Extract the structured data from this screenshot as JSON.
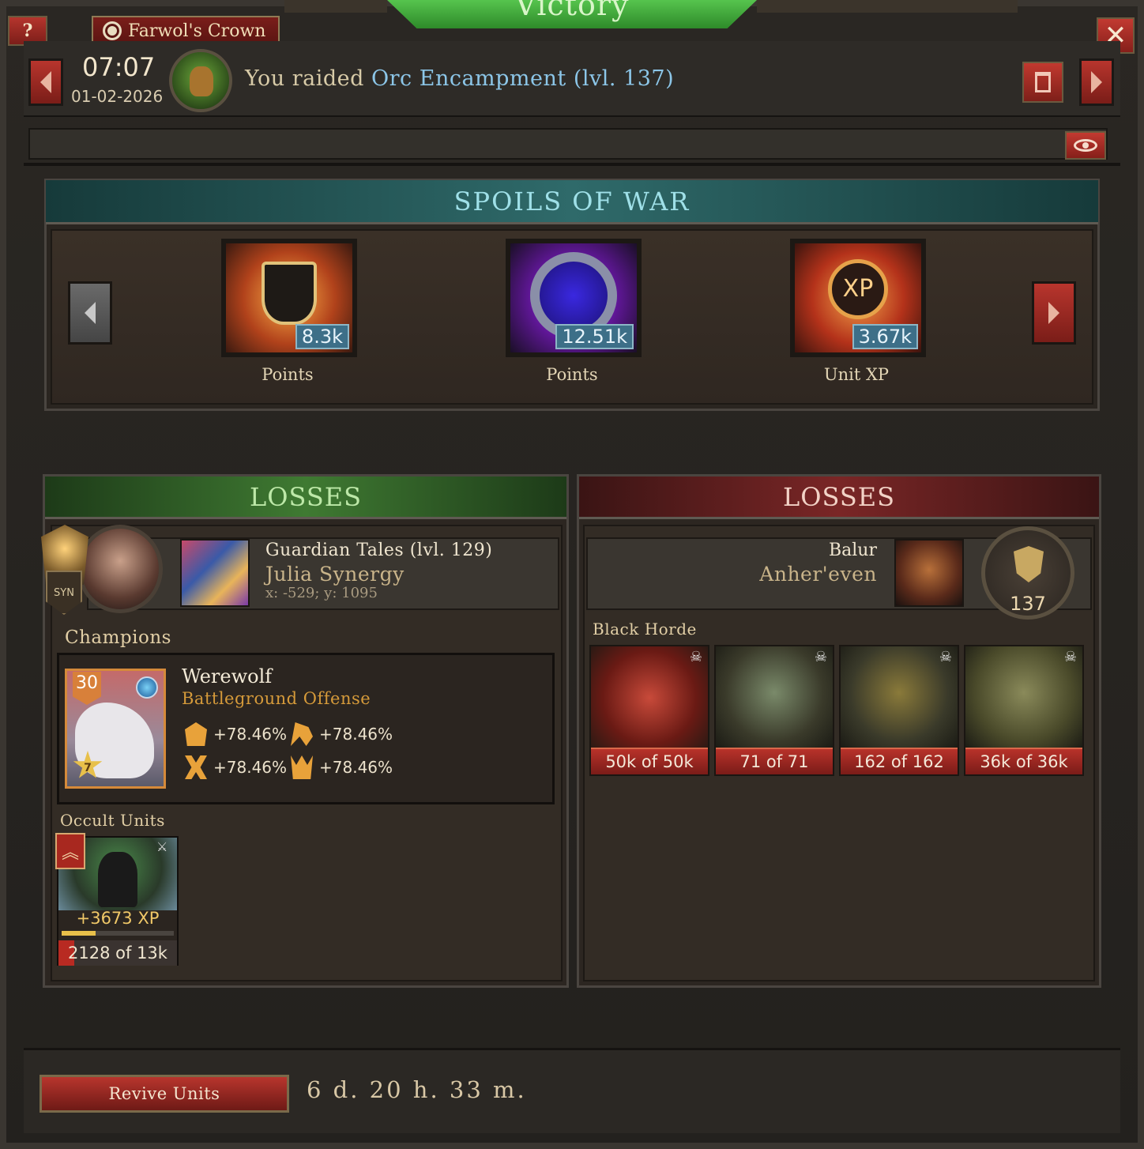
{
  "window": {
    "banner_title": "Victory",
    "realm": "Farwol's Crown",
    "help_label": "?",
    "close_label": "✕"
  },
  "report": {
    "time": "07:07",
    "date": "01-02-2026",
    "message_prefix": "You raided",
    "target": "Orc Encampment (lvl. 137)"
  },
  "spoils": {
    "title": "SPOILS OF WAR",
    "items": [
      {
        "amount": "8.3k",
        "label": "Points",
        "icon": "battle-banner-icon"
      },
      {
        "amount": "12.51k",
        "label": "Points",
        "icon": "arcane-gem-icon"
      },
      {
        "amount": "3.67k",
        "label": "Unit XP",
        "icon": "xp-icon"
      }
    ],
    "xp_glyph": "XP"
  },
  "attacker": {
    "losses_title": "LOSSES",
    "syn_label": "SYN",
    "guild": "Guardian Tales (lvl. 129)",
    "player": "Julia Synergy",
    "coords": "x: -529; y: 1095",
    "champions_label": "Champions",
    "champion": {
      "level": "30",
      "stars": "7",
      "name": "Werewolf",
      "role": "Battleground Offense",
      "bonuses": [
        "+78.46%",
        "+78.46%",
        "+78.46%",
        "+78.46%"
      ]
    },
    "units_label": "Occult Units",
    "unit": {
      "xp_gain": "+3673 XP",
      "xp_progress": 0.3,
      "count": "2128 of 13k"
    }
  },
  "defender": {
    "losses_title": "LOSSES",
    "name": "Balur",
    "sub": "Anher'even",
    "level": "137",
    "army_label": "Black Horde",
    "units": [
      {
        "loss": "50k of 50k"
      },
      {
        "loss": "71 of 71"
      },
      {
        "loss": "162 of 162"
      },
      {
        "loss": "36k of 36k"
      }
    ]
  },
  "footer": {
    "revive_label": "Revive Units",
    "timer": "6 d. 20 h. 33 m."
  },
  "colors": {
    "victory_green": "#3fa83a",
    "button_red": "#a32b24",
    "badge_blue": "#3d6f88",
    "target_blue": "#8cc6e8"
  }
}
